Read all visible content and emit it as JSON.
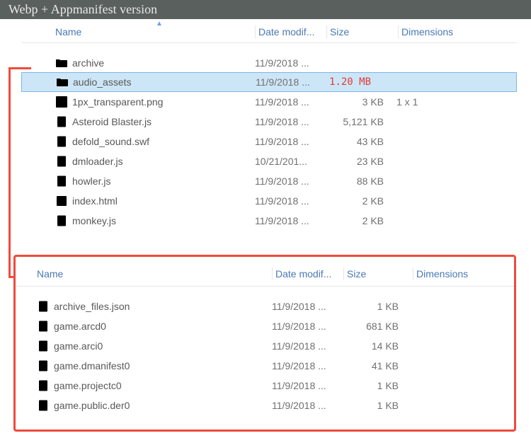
{
  "title": "Webp + Appmanifest version",
  "columns": {
    "name": "Name",
    "date": "Date modif...",
    "size": "Size",
    "dim": "Dimensions"
  },
  "columns2": {
    "name": "Name",
    "date": "Date modif...",
    "size": "Size",
    "dim": "Dimensions"
  },
  "top": [
    {
      "icon": "folder",
      "name": "archive",
      "date": "11/9/2018 ...",
      "size": "",
      "dim": "",
      "selected": false
    },
    {
      "icon": "folder",
      "name": "audio_assets",
      "date": "11/9/2018 ...",
      "size": "1.20 MB",
      "dim": "",
      "selected": true,
      "sizeHighlight": true
    },
    {
      "icon": "image",
      "name": "1px_transparent.png",
      "date": "11/9/2018 ...",
      "size": "3 KB",
      "dim": "1 x 1",
      "selected": false
    },
    {
      "icon": "script",
      "name": "Asteroid Blaster.js",
      "date": "11/9/2018 ...",
      "size": "5,121 KB",
      "dim": "",
      "selected": false
    },
    {
      "icon": "doc",
      "name": "defold_sound.swf",
      "date": "11/9/2018 ...",
      "size": "43 KB",
      "dim": "",
      "selected": false
    },
    {
      "icon": "script",
      "name": "dmloader.js",
      "date": "10/21/201...",
      "size": "23 KB",
      "dim": "",
      "selected": false
    },
    {
      "icon": "script",
      "name": "howler.js",
      "date": "11/9/2018 ...",
      "size": "88 KB",
      "dim": "",
      "selected": false
    },
    {
      "icon": "html",
      "name": "index.html",
      "date": "11/9/2018 ...",
      "size": "2 KB",
      "dim": "",
      "selected": false
    },
    {
      "icon": "script",
      "name": "monkey.js",
      "date": "11/9/2018 ...",
      "size": "2 KB",
      "dim": "",
      "selected": false
    }
  ],
  "bottom": [
    {
      "icon": "doc",
      "name": "archive_files.json",
      "date": "11/9/2018 ...",
      "size": "1 KB",
      "dim": ""
    },
    {
      "icon": "file",
      "name": "game.arcd0",
      "date": "11/9/2018 ...",
      "size": "681 KB",
      "dim": ""
    },
    {
      "icon": "file",
      "name": "game.arci0",
      "date": "11/9/2018 ...",
      "size": "14 KB",
      "dim": ""
    },
    {
      "icon": "file",
      "name": "game.dmanifest0",
      "date": "11/9/2018 ...",
      "size": "41 KB",
      "dim": ""
    },
    {
      "icon": "file",
      "name": "game.projectc0",
      "date": "11/9/2018 ...",
      "size": "1 KB",
      "dim": ""
    },
    {
      "icon": "file",
      "name": "game.public.der0",
      "date": "11/9/2018 ...",
      "size": "1 KB",
      "dim": ""
    }
  ]
}
